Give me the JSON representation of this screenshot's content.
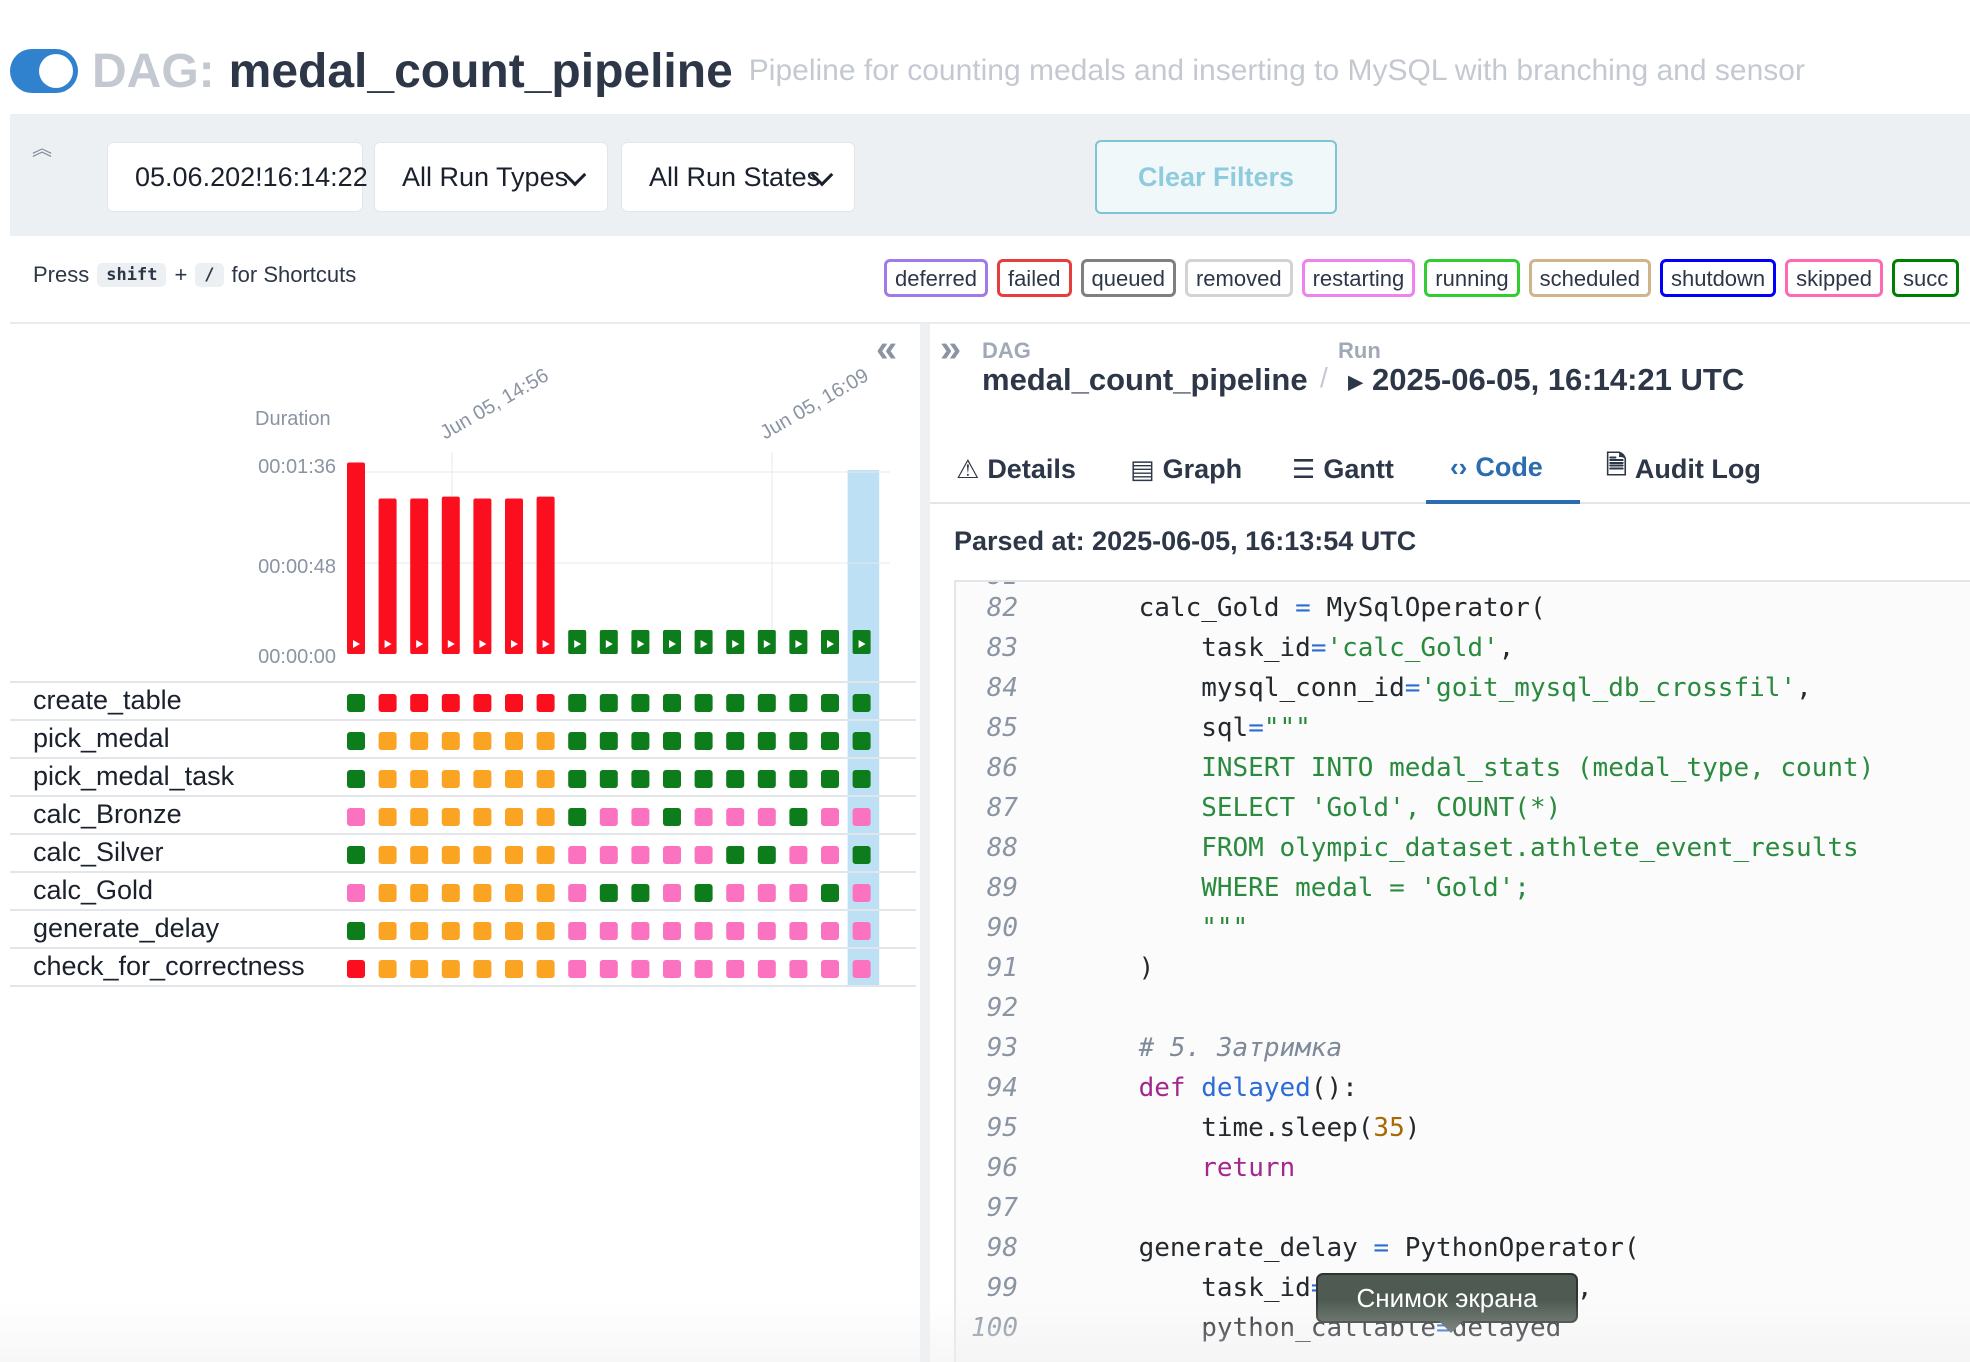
{
  "header": {
    "dag_prefix": "DAG:",
    "dag_name": "medal_count_pipeline",
    "description": "Pipeline for counting medals and inserting to MySQL with branching and sensor"
  },
  "filters": {
    "date_value": "05.06.202!16:14:22",
    "run_types": "All Run Types",
    "run_states": "All Run States",
    "clear": "Clear Filters"
  },
  "shortcuts": {
    "press": "Press",
    "key1": "shift",
    "plus": "+",
    "key2": "/",
    "suffix": "for Shortcuts"
  },
  "legend": [
    {
      "label": "deferred",
      "color": "#9f7aea"
    },
    {
      "label": "failed",
      "color": "#e53e3e"
    },
    {
      "label": "queued",
      "color": "#808080"
    },
    {
      "label": "removed",
      "color": "#d3d3d3"
    },
    {
      "label": "restarting",
      "color": "#ee82ee"
    },
    {
      "label": "running",
      "color": "#32cd32"
    },
    {
      "label": "scheduled",
      "color": "#d2b48c"
    },
    {
      "label": "shutdown",
      "color": "#0000ff"
    },
    {
      "label": "skipped",
      "color": "#ff69b4"
    },
    {
      "label": "succ",
      "color": "#008000"
    }
  ],
  "grid": {
    "duration_label": "Duration",
    "y_ticks": [
      "00:01:36",
      "00:00:48",
      "00:00:00"
    ],
    "x_ticks": [
      "Jun 05, 14:56",
      "Jun 05, 16:09"
    ],
    "colors": {
      "success": "#0d7c1a",
      "failed": "#fb0f1e",
      "upstream_failed": "#fba424",
      "skipped": "#fb73c0",
      "highlight": "#bee0f5"
    },
    "run_states": [
      "failed",
      "failed",
      "failed",
      "failed",
      "failed",
      "failed",
      "failed",
      "success",
      "success",
      "success",
      "success",
      "success",
      "success",
      "success",
      "success",
      "success",
      "success"
    ],
    "run_durations_sec": [
      101,
      82,
      82,
      83,
      82,
      82,
      83,
      8,
      8,
      8,
      8,
      8,
      8,
      8,
      8,
      8,
      8
    ],
    "y_max_sec": 96,
    "selected_run": 16,
    "tasks": [
      {
        "name": "create_table",
        "states": "SFFFFFFSSSSSSSSSS"
      },
      {
        "name": "pick_medal",
        "states": "SUUUUUUSSSSSSSSSS"
      },
      {
        "name": "pick_medal_task",
        "states": "SUUUUUUSSSSSSSSSS"
      },
      {
        "name": "calc_Bronze",
        "states": "KUUUUUUSKKSKKKSKK"
      },
      {
        "name": "calc_Silver",
        "states": "SUUUUUUKKKKKSSKKS"
      },
      {
        "name": "calc_Gold",
        "states": "KUUUUUUKSSKSKKKSK"
      },
      {
        "name": "generate_delay",
        "states": "SUUUUUUKKKKKKKKKK"
      },
      {
        "name": "check_for_correctness",
        "states": "FUUUUUUKKKKKKKKKK"
      }
    ]
  },
  "details": {
    "dag_label": "DAG",
    "dag_value": "medal_count_pipeline",
    "sep": "/",
    "run_label": "Run",
    "run_value": "2025-06-05, 16:14:21 UTC",
    "tabs": [
      {
        "label": "Details",
        "icon": "⚠"
      },
      {
        "label": "Graph",
        "icon": "▤"
      },
      {
        "label": "Gantt",
        "icon": "☰"
      },
      {
        "label": "Code",
        "icon": "‹›"
      },
      {
        "label": "Audit Log",
        "icon": "🗎"
      }
    ],
    "parsed_at": "Parsed at: 2025-06-05, 16:13:54 UTC"
  },
  "code": {
    "lines": [
      {
        "n": "82",
        "html": "    calc_Gold <span class=\"o\">=</span> MySqlOperator("
      },
      {
        "n": "83",
        "html": "        task_id<span class=\"o\">=</span><span class=\"s\">'calc_Gold'</span>,"
      },
      {
        "n": "84",
        "html": "        mysql_conn_id<span class=\"o\">=</span><span class=\"s\">'goit_mysql_db_crossfil'</span>,"
      },
      {
        "n": "85",
        "html": "        sql<span class=\"o\">=</span><span class=\"s\">\"\"\"</span>"
      },
      {
        "n": "86",
        "html": "<span class=\"s\">        INSERT INTO medal_stats (medal_type, count)</span>"
      },
      {
        "n": "87",
        "html": "<span class=\"s\">        SELECT 'Gold', COUNT(*)</span>"
      },
      {
        "n": "88",
        "html": "<span class=\"s\">        FROM olympic_dataset.athlete_event_results</span>"
      },
      {
        "n": "89",
        "html": "<span class=\"s\">        WHERE medal = 'Gold';</span>"
      },
      {
        "n": "90",
        "html": "<span class=\"s\">        \"\"\"</span>"
      },
      {
        "n": "91",
        "html": "    )"
      },
      {
        "n": "92",
        "html": ""
      },
      {
        "n": "93",
        "html": "    <span class=\"c\"># 5. Затримка</span>"
      },
      {
        "n": "94",
        "html": "    <span class=\"k\">def</span> <span class=\"f\">delayed</span>():"
      },
      {
        "n": "95",
        "html": "        time.sleep(<span class=\"n\">35</span>)"
      },
      {
        "n": "96",
        "html": "        <span class=\"k\">return</span>"
      },
      {
        "n": "97",
        "html": ""
      },
      {
        "n": "98",
        "html": "    generate_delay <span class=\"o\">=</span> PythonOperator("
      },
      {
        "n": "99",
        "html": "        task_id<span class=\"o\">=</span><span class=\"s\">'generate_delay'</span>,"
      },
      {
        "n": "100",
        "html": "        python_callable<span class=\"o\">=</span>delayed"
      }
    ]
  },
  "tooltip": "Снимок экрана"
}
